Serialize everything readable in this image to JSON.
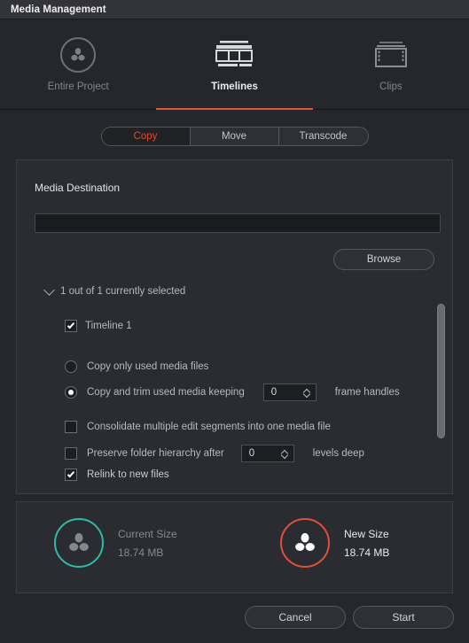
{
  "window": {
    "title": "Media Management"
  },
  "modes": [
    {
      "id": "entire-project",
      "label": "Entire Project",
      "icon": "resolve-logo-icon",
      "active": false
    },
    {
      "id": "timelines",
      "label": "Timelines",
      "icon": "timeline-tracks-icon",
      "active": true
    },
    {
      "id": "clips",
      "label": "Clips",
      "icon": "film-strip-icon",
      "active": false
    }
  ],
  "segmented": {
    "options": [
      {
        "id": "copy",
        "label": "Copy",
        "active": true
      },
      {
        "id": "move",
        "label": "Move",
        "active": false
      },
      {
        "id": "transcode",
        "label": "Transcode",
        "active": false
      }
    ]
  },
  "destination": {
    "section_title": "Media Destination",
    "path_value": "",
    "path_placeholder": "",
    "browse_label": "Browse"
  },
  "selection": {
    "summary": "1 out of 1 currently selected",
    "expanded": true,
    "items": [
      {
        "label": "Timeline 1",
        "checked": true
      }
    ]
  },
  "copy_mode": {
    "options": [
      {
        "id": "copy-only-used",
        "label": "Copy only used media files",
        "selected": false
      },
      {
        "id": "copy-and-trim",
        "label": "Copy and trim used media keeping",
        "selected": true
      }
    ],
    "frame_handles": {
      "value": "0",
      "suffix": "frame handles"
    }
  },
  "options": [
    {
      "id": "consolidate",
      "label": "Consolidate multiple edit segments into one media file",
      "checked": false
    },
    {
      "id": "preserve-hierarchy",
      "label": "Preserve folder hierarchy after",
      "checked": false,
      "value": "0",
      "suffix": "levels deep"
    },
    {
      "id": "relink",
      "label": "Relink to new files",
      "checked": true
    }
  ],
  "sizes": [
    {
      "id": "current-size",
      "label": "Current Size",
      "value": "18.74 MB",
      "ring_color": "#2ebaa4",
      "emphasis": "dim"
    },
    {
      "id": "new-size",
      "label": "New Size",
      "value": "18.74 MB",
      "ring_color": "#e0503a",
      "emphasis": "bright"
    }
  ],
  "footer": {
    "cancel_label": "Cancel",
    "start_label": "Start"
  },
  "colors": {
    "accent_red": "#e4503a",
    "accent_teal": "#2ebaa4",
    "panel_bg": "#2b2c31",
    "window_bg": "#26272c"
  }
}
